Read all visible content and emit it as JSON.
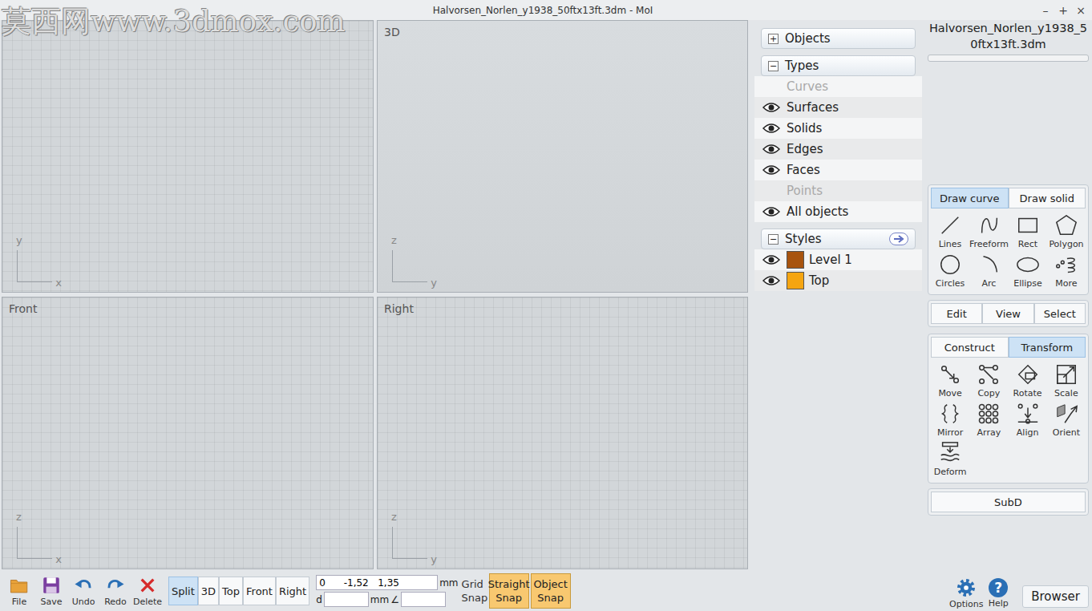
{
  "window": {
    "title": "Halvorsen_Norlen_y1938_50ftx13ft.3dm - MoI",
    "controls": [
      "–",
      "+",
      "×"
    ]
  },
  "watermark": "莫西网www.3dmox.com",
  "viewports": [
    {
      "kind": "top",
      "axes": [
        "y",
        "x"
      ]
    },
    {
      "kind": "3d",
      "label": "3D",
      "axes": [
        "z",
        "y"
      ]
    },
    {
      "kind": "front",
      "label": "Front",
      "axes": [
        "z",
        "x"
      ]
    },
    {
      "kind": "right",
      "label": "Right",
      "axes": [
        "z",
        "y"
      ]
    }
  ],
  "scene_browser": {
    "objects": {
      "label": "Objects",
      "toggle": "+",
      "expanded": false
    },
    "types": {
      "label": "Types",
      "toggle": "−",
      "expanded": true,
      "items": [
        {
          "label": "Curves",
          "visible": false,
          "disabled": true
        },
        {
          "label": "Surfaces",
          "visible": true,
          "disabled": false
        },
        {
          "label": "Solids",
          "visible": true,
          "disabled": false
        },
        {
          "label": "Edges",
          "visible": true,
          "disabled": false
        },
        {
          "label": "Faces",
          "visible": true,
          "disabled": false
        },
        {
          "label": "Points",
          "visible": false,
          "disabled": true
        },
        {
          "label": "All objects",
          "visible": true,
          "disabled": false
        }
      ]
    },
    "styles": {
      "label": "Styles",
      "toggle": "−",
      "expanded": true,
      "items": [
        {
          "label": "Level 1",
          "visible": true,
          "color": "#a8540f"
        },
        {
          "label": "Top",
          "visible": true,
          "color": "#f5a511"
        }
      ]
    }
  },
  "file_name": "Halvorsen_Norlen_y1938_50ftx13ft.3dm",
  "draw_tabs": [
    {
      "label": "Draw curve",
      "selected": true
    },
    {
      "label": "Draw solid",
      "selected": false
    }
  ],
  "draw_tools": [
    {
      "label": "Lines",
      "kind": "lines"
    },
    {
      "label": "Freeform",
      "kind": "freeform"
    },
    {
      "label": "Rect",
      "kind": "rect"
    },
    {
      "label": "Polygon",
      "kind": "polygon"
    },
    {
      "label": "Circles",
      "kind": "circles"
    },
    {
      "label": "Arc",
      "kind": "arc"
    },
    {
      "label": "Ellipse",
      "kind": "ellipse"
    },
    {
      "label": "More",
      "kind": "more"
    }
  ],
  "menu_buttons": [
    "Edit",
    "View",
    "Select"
  ],
  "transform_tabs": [
    {
      "label": "Construct",
      "selected": false
    },
    {
      "label": "Transform",
      "selected": true
    }
  ],
  "transform_tools": [
    {
      "label": "Move",
      "kind": "move"
    },
    {
      "label": "Copy",
      "kind": "copy"
    },
    {
      "label": "Rotate",
      "kind": "rotate"
    },
    {
      "label": "Scale",
      "kind": "scale"
    },
    {
      "label": "Mirror",
      "kind": "mirror"
    },
    {
      "label": "Array",
      "kind": "array"
    },
    {
      "label": "Align",
      "kind": "align"
    },
    {
      "label": "Orient",
      "kind": "orient"
    },
    {
      "label": "Deform",
      "kind": "deform"
    }
  ],
  "subd": "SubD",
  "bottom": {
    "file_buttons": [
      {
        "label": "File",
        "kind": "file"
      },
      {
        "label": "Save",
        "kind": "save"
      },
      {
        "label": "Undo",
        "kind": "undo"
      },
      {
        "label": "Redo",
        "kind": "redo"
      },
      {
        "label": "Delete",
        "kind": "delete"
      }
    ],
    "views": [
      {
        "label": "Split",
        "selected": true
      },
      {
        "label": "3D",
        "selected": false
      },
      {
        "label": "Top",
        "selected": false
      },
      {
        "label": "Front",
        "selected": false
      },
      {
        "label": "Right",
        "selected": false
      }
    ],
    "coords": "0      -1,52   1,35",
    "unit": "mm",
    "distance_label": "d",
    "distance_unit": "mm",
    "angle_label": "∠",
    "grid_snap": "Grid Snap",
    "snaps": [
      {
        "label": "Straight Snap",
        "on": true
      },
      {
        "label": "Object Snap",
        "on": true
      }
    ],
    "help_buttons": [
      {
        "label": "Options",
        "kind": "options"
      },
      {
        "label": "Help",
        "kind": "help",
        "glyph": "?"
      }
    ],
    "browser": "Browser"
  }
}
